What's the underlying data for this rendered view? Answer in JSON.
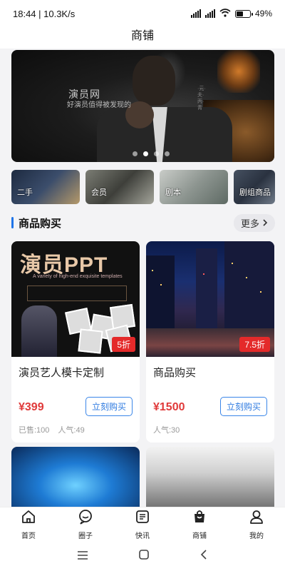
{
  "status": {
    "time_speed": "18:44 | 10.3K/s",
    "net1": "HD",
    "net2": "HD",
    "battery": "49%",
    "battery_level": 0.49
  },
  "header": {
    "title": "商铺"
  },
  "banner": {
    "title": "演员网",
    "subtitle": "好演员值得被发现的",
    "side_text": "·元·夫·丙·青"
  },
  "categories": [
    {
      "label": "二手"
    },
    {
      "label": "会员"
    },
    {
      "label": "剧本"
    },
    {
      "label": "剧组商品"
    }
  ],
  "section": {
    "title": "商品购买",
    "more": "更多"
  },
  "products": [
    {
      "name": "演员艺人模卡定制",
      "price": "¥399",
      "badge": "5折",
      "buy": "立刻购买",
      "sold": "已售:100",
      "popularity": "人气:49",
      "img_title": "演员PPT",
      "img_sub": "A variety of high-end exquisite templates"
    },
    {
      "name": "商品购买",
      "price": "¥1500",
      "badge": "7.5折",
      "buy": "立刻购买",
      "popularity": "人气:30"
    }
  ],
  "tabs": [
    {
      "label": "首页",
      "icon": "home-icon"
    },
    {
      "label": "圈子",
      "icon": "chat-icon"
    },
    {
      "label": "快讯",
      "icon": "news-icon"
    },
    {
      "label": "商铺",
      "icon": "shop-icon",
      "active": true
    },
    {
      "label": "我的",
      "icon": "user-icon"
    }
  ],
  "colors": {
    "accent": "#1f74e8",
    "price": "#e03a3a",
    "badge": "#e42a2a"
  }
}
